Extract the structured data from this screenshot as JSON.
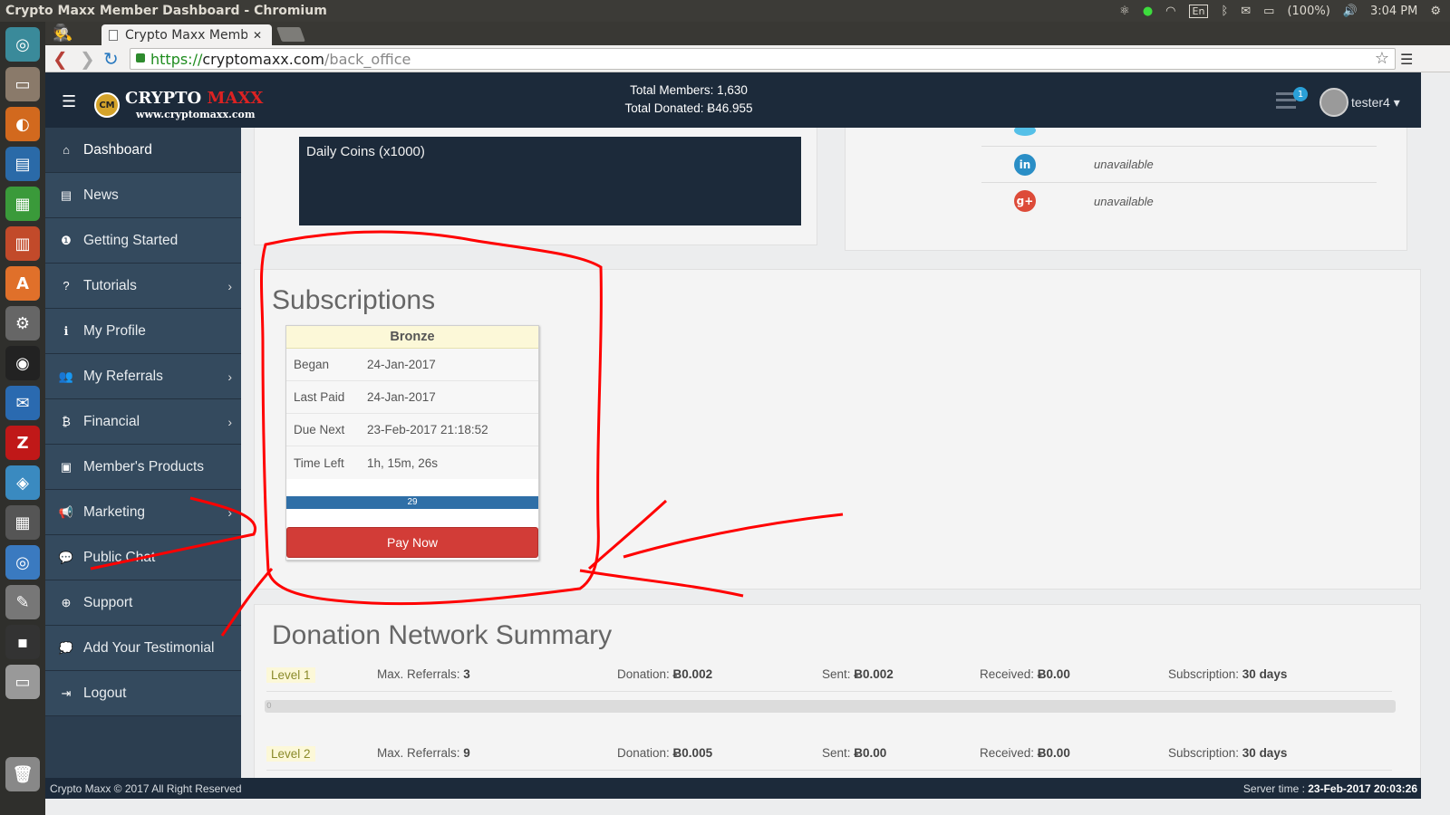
{
  "os": {
    "window_title": "Crypto Maxx Member Dashboard - Chromium",
    "battery": "(100%)",
    "clock": "3:04 PM",
    "keyboard": "En"
  },
  "browser": {
    "tab_title": "Crypto Maxx Memb",
    "url_scheme": "https://",
    "url_host": "cryptomaxx.com",
    "url_path": "/back_office"
  },
  "header": {
    "logo_crypto": "CRYPTO",
    "logo_maxx": "MAXX",
    "logo_site": "www.cryptomaxx.com",
    "logo_badge": "CM",
    "total_members": "Total Members: 1,630",
    "total_donated": "Total Donated: Ƀ46.955",
    "notification_count": "1",
    "username": "tester4 ▾"
  },
  "sidebar": {
    "items": [
      {
        "label": "Dashboard",
        "icon": "home-icon",
        "glyph": "⌂"
      },
      {
        "label": "News",
        "icon": "newspaper-icon",
        "glyph": "▤"
      },
      {
        "label": "Getting Started",
        "icon": "info-circle-icon",
        "glyph": "❶"
      },
      {
        "label": "Tutorials",
        "icon": "question-circle-icon",
        "glyph": "?"
      },
      {
        "label": "My Profile",
        "icon": "info-icon",
        "glyph": "ℹ"
      },
      {
        "label": "My Referrals",
        "icon": "users-icon",
        "glyph": "👥"
      },
      {
        "label": "Financial",
        "icon": "bitcoin-icon",
        "glyph": "₿"
      },
      {
        "label": "Member's Products",
        "icon": "id-card-icon",
        "glyph": "▣"
      },
      {
        "label": "Marketing",
        "icon": "bullhorn-icon",
        "glyph": "📢"
      },
      {
        "label": "Public Chat",
        "icon": "comments-icon",
        "glyph": "💬"
      },
      {
        "label": "Support",
        "icon": "life-ring-icon",
        "glyph": "⊕"
      },
      {
        "label": "Add Your Testimonial",
        "icon": "comment-icon",
        "glyph": "💭"
      },
      {
        "label": "Logout",
        "icon": "sign-out-icon",
        "glyph": "⇥"
      }
    ]
  },
  "daily_coins": {
    "title": "Daily Coins (x1000)"
  },
  "social": {
    "linkedin_status": "unavailable",
    "googleplus_status": "unavailable",
    "linkedin_glyph": "in",
    "googleplus_glyph": "g+"
  },
  "subscriptions": {
    "title": "Subscriptions",
    "plan": "Bronze",
    "rows": [
      {
        "label": "Began",
        "value": "24-Jan-2017"
      },
      {
        "label": "Last Paid",
        "value": "24-Jan-2017"
      },
      {
        "label": "Due Next",
        "value": "23-Feb-2017 21:18:52"
      },
      {
        "label": "Time Left",
        "value": "1h, 15m, 26s"
      }
    ],
    "progress_label": "29",
    "progress_fraction": 1.0,
    "pay_button": "Pay Now"
  },
  "donation_summary": {
    "title": "Donation Network Summary",
    "bar_label": "0",
    "levels": [
      {
        "level": "Level 1",
        "max_referrals_label": "Max. Referrals: ",
        "max_referrals": "3",
        "donation_label": "Donation: ",
        "donation": "Ƀ0.002",
        "sent_label": "Sent: ",
        "sent": "Ƀ0.002",
        "received_label": "Received: ",
        "received": "Ƀ0.00",
        "subscription_label": "Subscription: ",
        "subscription": "30 days"
      },
      {
        "level": "Level 2",
        "max_referrals_label": "Max. Referrals: ",
        "max_referrals": "9",
        "donation_label": "Donation: ",
        "donation": "Ƀ0.005",
        "sent_label": "Sent: ",
        "sent": "Ƀ0.00",
        "received_label": "Received: ",
        "received": "Ƀ0.00",
        "subscription_label": "Subscription: ",
        "subscription": "30 days"
      }
    ]
  },
  "footer": {
    "copyright": "Crypto Maxx © 2017 All Right Reserved",
    "server_time_label": "Server time : ",
    "server_time": "23-Feb-2017 20:03:26"
  },
  "colors": {
    "header_bg": "#1c2a3a",
    "sidebar_bg": "#344a5e",
    "pay_button": "#d23c37",
    "progress": "#2f6fa7",
    "annotation": "#ff0000"
  }
}
